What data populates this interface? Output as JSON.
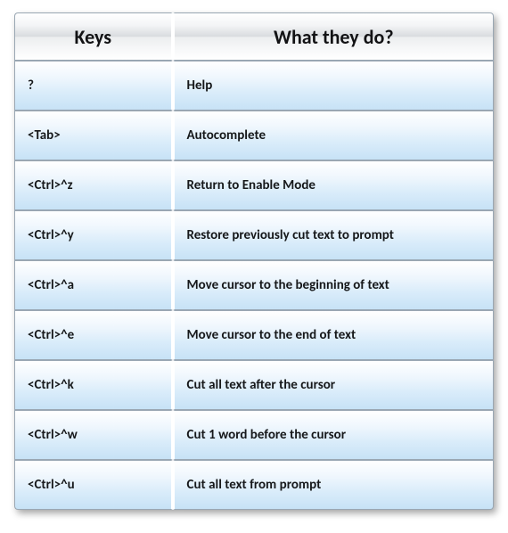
{
  "table": {
    "headers": {
      "keys": "Keys",
      "desc": "What they do?"
    },
    "rows": [
      {
        "key": "?",
        "desc": "Help"
      },
      {
        "key": "<Tab>",
        "desc": "Autocomplete"
      },
      {
        "key": "<Ctrl>^z",
        "desc": "Return to Enable Mode"
      },
      {
        "key": "<Ctrl>^y",
        "desc": "Restore previously cut text to prompt"
      },
      {
        "key": "<Ctrl>^a",
        "desc": "Move cursor to the beginning of text"
      },
      {
        "key": "<Ctrl>^e",
        "desc": "Move cursor to the end of text"
      },
      {
        "key": "<Ctrl>^k",
        "desc": "Cut all text after the cursor"
      },
      {
        "key": "<Ctrl>^w",
        "desc": "Cut 1 word before the cursor"
      },
      {
        "key": "<Ctrl>^u",
        "desc": "Cut all text from prompt"
      }
    ]
  }
}
